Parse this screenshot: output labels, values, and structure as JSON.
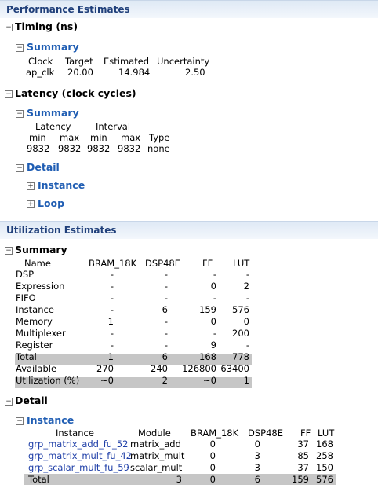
{
  "perf": {
    "header": "Performance Estimates",
    "timing_title": "Timing (ns)",
    "timing_summary": "Summary",
    "timing_cols": [
      "Clock",
      "Target",
      "Estimated",
      "Uncertainty"
    ],
    "timing_row": [
      "ap_clk",
      "20.00",
      "14.984",
      "2.50"
    ],
    "latency_title": "Latency (clock cycles)",
    "latency_summary": "Summary",
    "latency_group": [
      "Latency",
      "Interval"
    ],
    "latency_cols": [
      "min",
      "max",
      "min",
      "max",
      "Type"
    ],
    "latency_row": [
      "9832",
      "9832",
      "9832",
      "9832",
      "none"
    ],
    "detail": "Detail",
    "instance": "Instance",
    "loop": "Loop"
  },
  "util": {
    "header": "Utilization Estimates",
    "summary_title": "Summary",
    "cols": [
      "Name",
      "BRAM_18K",
      "DSP48E",
      "FF",
      "LUT"
    ],
    "rows": [
      [
        "DSP",
        "-",
        "-",
        "-",
        "-"
      ],
      [
        "Expression",
        "-",
        "-",
        "0",
        "2"
      ],
      [
        "FIFO",
        "-",
        "-",
        "-",
        "-"
      ],
      [
        "Instance",
        "-",
        "6",
        "159",
        "576"
      ],
      [
        "Memory",
        "1",
        "-",
        "0",
        "0"
      ],
      [
        "Multiplexer",
        "-",
        "-",
        "-",
        "200"
      ],
      [
        "Register",
        "-",
        "-",
        "9",
        "-"
      ],
      [
        "Total",
        "1",
        "6",
        "168",
        "778"
      ],
      [
        "Available",
        "270",
        "240",
        "126800",
        "63400"
      ],
      [
        "Utilization (%)",
        "~0",
        "2",
        "~0",
        "1"
      ]
    ],
    "detail_title": "Detail",
    "instance_title": "Instance",
    "inst_cols": [
      "Instance",
      "Module",
      "BRAM_18K",
      "DSP48E",
      "FF",
      "LUT"
    ],
    "inst_rows": [
      [
        "grp_matrix_add_fu_52",
        "matrix_add",
        "0",
        "0",
        "37",
        "168"
      ],
      [
        "grp_matrix_mult_fu_42",
        "matrix_mult",
        "0",
        "3",
        "85",
        "258"
      ],
      [
        "grp_scalar_mult_fu_59",
        "scalar_mult",
        "0",
        "3",
        "37",
        "150"
      ],
      [
        "Total",
        "",
        "3",
        "0",
        "6",
        "159",
        "576"
      ]
    ],
    "inst_total": [
      "Total",
      "3",
      "0",
      "6",
      "159",
      "576"
    ]
  }
}
